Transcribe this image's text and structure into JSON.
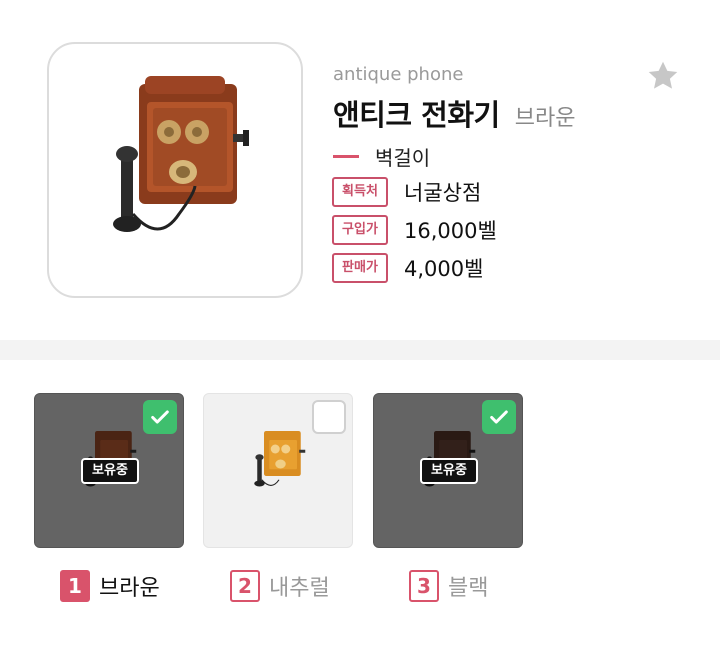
{
  "item": {
    "english_name": "antique phone",
    "name": "앤티크 전화기",
    "variant": "브라운",
    "category": "벽걸이",
    "favorite_icon": "star-icon"
  },
  "info": [
    {
      "label": "획득처",
      "value": "너굴상점"
    },
    {
      "label": "구입가",
      "value": "16,000벨"
    },
    {
      "label": "판매가",
      "value": "4,000벨"
    }
  ],
  "variants": [
    {
      "number": "1",
      "name": "브라운",
      "owned": true,
      "badge": "보유중",
      "color": "#8a3b1c"
    },
    {
      "number": "2",
      "name": "내추럴",
      "owned": false,
      "badge": "",
      "color": "#e8a030"
    },
    {
      "number": "3",
      "name": "블랙",
      "owned": true,
      "badge": "보유중",
      "color": "#3a2620"
    }
  ],
  "colors": {
    "accent": "#d9536b",
    "check_green": "#3fbf6e",
    "owned_card_bg": "#646464"
  }
}
